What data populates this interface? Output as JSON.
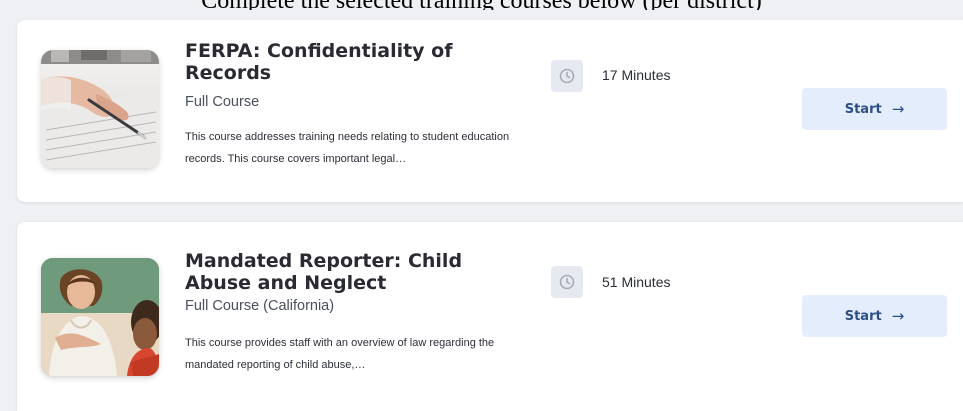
{
  "header": {
    "partial_text": "Complete the selected training courses below (per district)"
  },
  "courses": [
    {
      "title": "FERPA: Confidentiality of Records",
      "type": "Full Course",
      "description": "This course addresses training needs relating to student education records. This course covers important legal…",
      "duration": "17 Minutes",
      "start_label": "Start",
      "arrow": "→",
      "icon": "clock-icon",
      "image": "hand-writing-on-paper"
    },
    {
      "title": "Mandated Reporter: Child Abuse and Neglect",
      "type": "Full Course (California)",
      "description": "This course provides staff with an overview of law regarding the mandated reporting of child abuse,…",
      "duration": "51 Minutes",
      "start_label": "Start",
      "arrow": "→",
      "icon": "clock-icon",
      "image": "teacher-in-classroom"
    }
  ],
  "colors": {
    "page_background": "#eef0f4",
    "card_background": "#ffffff",
    "button_background": "#e4edfb",
    "button_text": "#2c4f86",
    "clock_box": "#e6e9ef"
  }
}
